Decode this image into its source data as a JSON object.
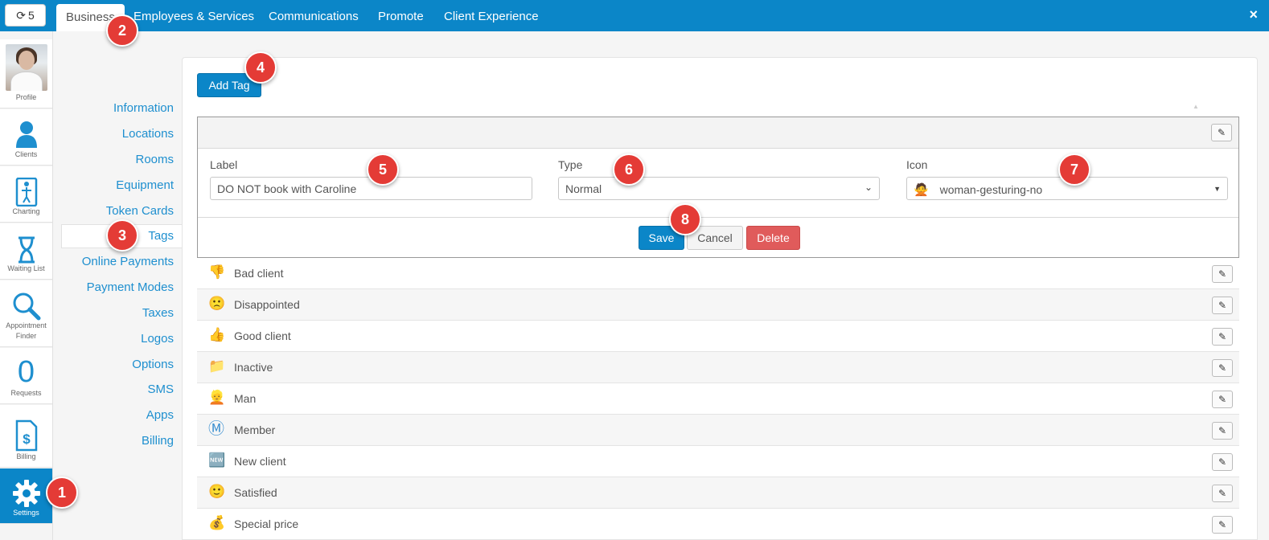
{
  "topbar": {
    "refresh_count": "5",
    "tabs": [
      "Business",
      "Employees & Services",
      "Communications",
      "Promote",
      "Client Experience"
    ],
    "close": "×"
  },
  "iconbar": {
    "items": [
      "Profile",
      "Clients",
      "Charting",
      "Waiting List",
      "Appointment Finder",
      "Requests",
      "Billing",
      "Settings"
    ],
    "requests_count": "0"
  },
  "subnav": {
    "items": [
      "Information",
      "Locations",
      "Rooms",
      "Equipment",
      "Token Cards",
      "Tags",
      "Online Payments",
      "Payment Modes",
      "Taxes",
      "Logos",
      "Options",
      "SMS",
      "Apps",
      "Billing"
    ]
  },
  "main": {
    "add_tag": "Add Tag",
    "edit": {
      "label_label": "Label",
      "label_value": "DO NOT book with Caroline",
      "type_label": "Type",
      "type_value": "Normal",
      "icon_label": "Icon",
      "icon_value": "woman-gesturing-no",
      "icon_glyph": "🙅",
      "save": "Save",
      "cancel": "Cancel",
      "delete": "Delete"
    },
    "tags": [
      {
        "name": "Bad client",
        "icon": "👎"
      },
      {
        "name": "Disappointed",
        "icon": "🙁"
      },
      {
        "name": "Good client",
        "icon": "👍"
      },
      {
        "name": "Inactive",
        "icon": "📁"
      },
      {
        "name": "Man",
        "icon": "👱"
      },
      {
        "name": "Member",
        "icon": "Ⓜ"
      },
      {
        "name": "New client",
        "icon": "🆕"
      },
      {
        "name": "Satisfied",
        "icon": "🙂"
      },
      {
        "name": "Special price",
        "icon": "💰"
      }
    ]
  },
  "callouts": [
    "1",
    "2",
    "3",
    "4",
    "5",
    "6",
    "7",
    "8"
  ]
}
